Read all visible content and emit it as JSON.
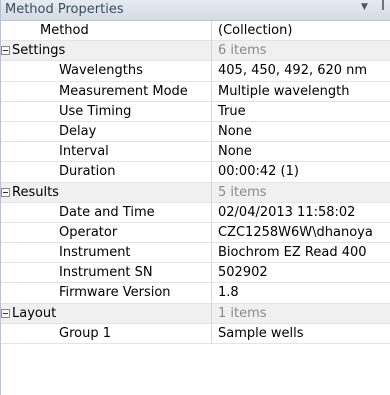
{
  "panel": {
    "title": "Method Properties",
    "dropdown_icon": "chevron-down-icon",
    "pin_icon": "pin-icon"
  },
  "rows": {
    "method": {
      "name": "Method",
      "value": "(Collection)"
    },
    "settings": {
      "name": "Settings",
      "value": "6 items",
      "items": [
        {
          "name": "Wavelengths",
          "value": "405, 450, 492, 620 nm"
        },
        {
          "name": "Measurement Mode",
          "value": "Multiple wavelength"
        },
        {
          "name": "Use Timing",
          "value": "True"
        },
        {
          "name": "Delay",
          "value": "None"
        },
        {
          "name": "Interval",
          "value": "None"
        },
        {
          "name": "Duration",
          "value": "00:00:42 (1)"
        }
      ]
    },
    "results": {
      "name": "Results",
      "value": "5 items",
      "items": [
        {
          "name": "Date and Time",
          "value": "02/04/2013 11:58:02"
        },
        {
          "name": "Operator",
          "value": "CZC1258W6W\\dhanoya"
        },
        {
          "name": "Instrument",
          "value": "Biochrom EZ Read 400"
        },
        {
          "name": "Instrument SN",
          "value": "502902"
        },
        {
          "name": "Firmware Version",
          "value": "1.8"
        }
      ]
    },
    "layout": {
      "name": "Layout",
      "value": "1 items",
      "items": [
        {
          "name": "Group 1",
          "value": "Sample wells"
        }
      ]
    }
  }
}
